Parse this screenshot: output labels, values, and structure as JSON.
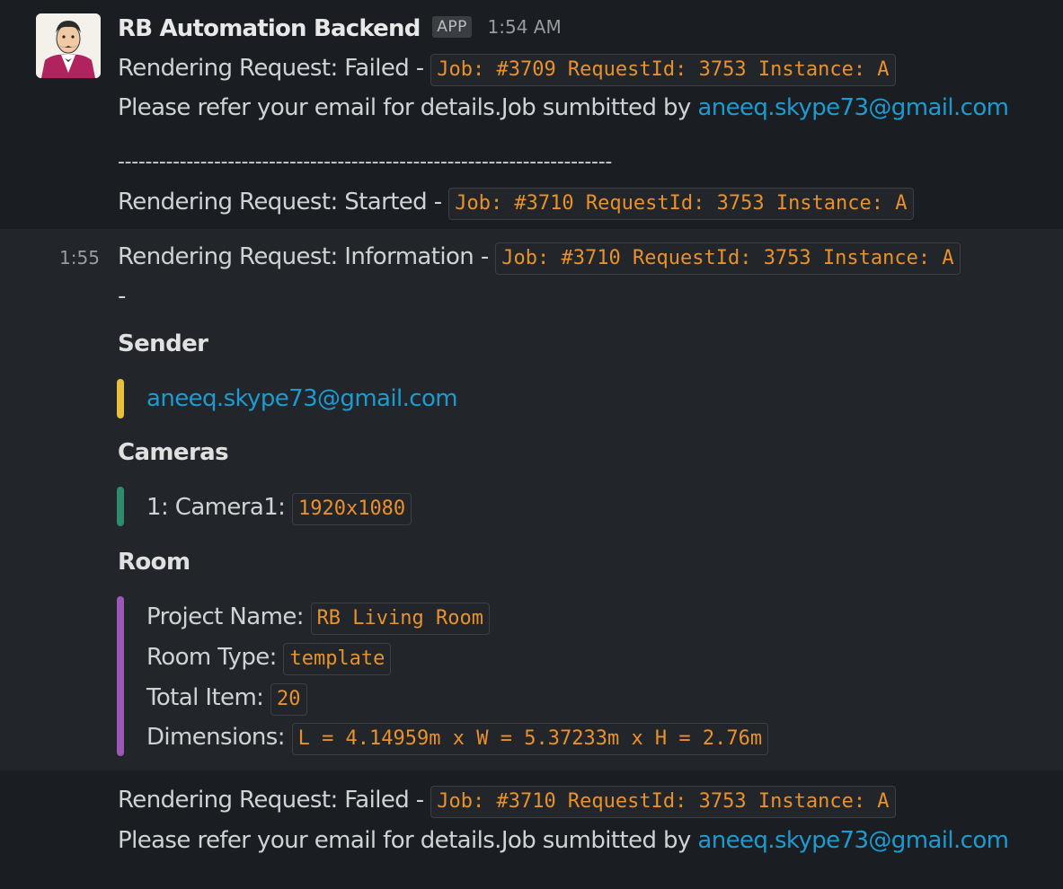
{
  "msg1": {
    "sender_name": "RB Automation Backend",
    "app_badge": "APP",
    "timestamp": "1:54 AM",
    "line1_text": "Rendering Request: Failed - ",
    "line1_code": "Job: #3709 RequestId: 3753 Instance: A",
    "line2_text": "Please refer your email for details.Job sumbitted by ",
    "line2_link": "aneeq.skype73@gmail.com",
    "divider": "------------------------------------------------------------------------",
    "line3_text": "Rendering Request: Started - ",
    "line3_code": "Job: #3710 RequestId: 3753 Instance: A"
  },
  "msg2": {
    "timestamp": "1:55",
    "line1_text": "Rendering Request: Information - ",
    "line1_code": "Job: #3710 RequestId: 3753 Instance: A",
    "dash": "-",
    "sender_heading": "Sender",
    "sender_email": "aneeq.skype73@gmail.com",
    "cameras_heading": "Cameras",
    "camera1_label": "1: Camera1: ",
    "camera1_code": "1920x1080",
    "room_heading": "Room",
    "project_label": "Project Name: ",
    "project_code": "RB Living Room",
    "roomtype_label": "Room Type: ",
    "roomtype_code": "template",
    "totalitem_label": "Total Item: ",
    "totalitem_code": "20",
    "dimensions_label": "Dimensions: ",
    "dimensions_code": "L = 4.14959m x W = 5.37233m x H = 2.76m"
  },
  "msg3": {
    "line1_text": "Rendering Request: Failed - ",
    "line1_code": "Job: #3710 RequestId: 3753 Instance: A",
    "line2_text": "Please refer your email for details.Job sumbitted by ",
    "line2_link": "aneeq.skype73@gmail.com"
  }
}
